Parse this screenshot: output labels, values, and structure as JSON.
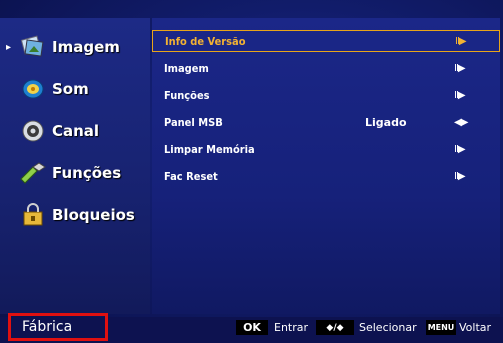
{
  "sidebar": {
    "items": [
      {
        "label": "Imagem",
        "icon": "image-icon",
        "selected": true
      },
      {
        "label": "Som",
        "icon": "speaker-icon"
      },
      {
        "label": "Canal",
        "icon": "channel-icon"
      },
      {
        "label": "Funções",
        "icon": "functions-icon"
      },
      {
        "label": "Bloqueios",
        "icon": "lock-icon"
      }
    ],
    "current_arrow": "▸"
  },
  "menu": {
    "rows": [
      {
        "label": "Info de Versão",
        "right_icon": "submenu-icon",
        "value": ""
      },
      {
        "label": "Imagem",
        "right_icon": "submenu-icon",
        "value": ""
      },
      {
        "label": "Funções",
        "right_icon": "submenu-icon",
        "value": ""
      },
      {
        "label": "Panel MSB",
        "right_icon": "left-right-icon",
        "value": "Ligado"
      },
      {
        "label": "Limpar Memória",
        "right_icon": "submenu-icon",
        "value": ""
      },
      {
        "label": "Fac Reset",
        "right_icon": "submenu-icon",
        "value": ""
      }
    ],
    "submenu_glyph": "II▶",
    "left_right_glyph": "◀▶"
  },
  "footer": {
    "mode_label": "Fábrica",
    "ok_key": "OK",
    "ok_hint": "Entrar",
    "nav_key": "◆/◆",
    "nav_hint": "Selecionar",
    "menu_key": "MENU",
    "menu_hint": "Voltar"
  },
  "colors": {
    "highlight": "#e8a41a",
    "background": "#16217a",
    "fabrica_box": "#e01010"
  }
}
